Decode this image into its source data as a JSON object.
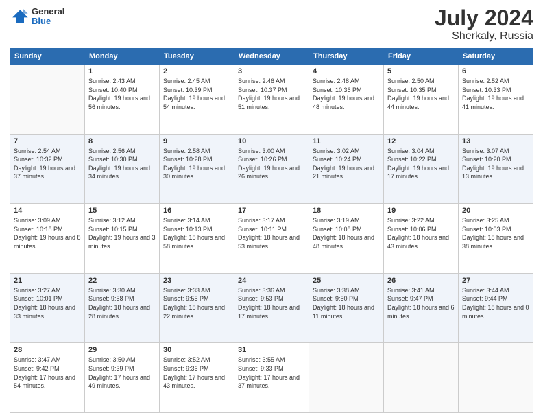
{
  "header": {
    "logo": {
      "general": "General",
      "blue": "Blue"
    },
    "month": "July 2024",
    "location": "Sherkaly, Russia"
  },
  "weekdays": [
    "Sunday",
    "Monday",
    "Tuesday",
    "Wednesday",
    "Thursday",
    "Friday",
    "Saturday"
  ],
  "weeks": [
    [
      {
        "day": "",
        "sunrise": "",
        "sunset": "",
        "daylight": ""
      },
      {
        "day": "1",
        "sunrise": "Sunrise: 2:43 AM",
        "sunset": "Sunset: 10:40 PM",
        "daylight": "Daylight: 19 hours and 56 minutes."
      },
      {
        "day": "2",
        "sunrise": "Sunrise: 2:45 AM",
        "sunset": "Sunset: 10:39 PM",
        "daylight": "Daylight: 19 hours and 54 minutes."
      },
      {
        "day": "3",
        "sunrise": "Sunrise: 2:46 AM",
        "sunset": "Sunset: 10:37 PM",
        "daylight": "Daylight: 19 hours and 51 minutes."
      },
      {
        "day": "4",
        "sunrise": "Sunrise: 2:48 AM",
        "sunset": "Sunset: 10:36 PM",
        "daylight": "Daylight: 19 hours and 48 minutes."
      },
      {
        "day": "5",
        "sunrise": "Sunrise: 2:50 AM",
        "sunset": "Sunset: 10:35 PM",
        "daylight": "Daylight: 19 hours and 44 minutes."
      },
      {
        "day": "6",
        "sunrise": "Sunrise: 2:52 AM",
        "sunset": "Sunset: 10:33 PM",
        "daylight": "Daylight: 19 hours and 41 minutes."
      }
    ],
    [
      {
        "day": "7",
        "sunrise": "Sunrise: 2:54 AM",
        "sunset": "Sunset: 10:32 PM",
        "daylight": "Daylight: 19 hours and 37 minutes."
      },
      {
        "day": "8",
        "sunrise": "Sunrise: 2:56 AM",
        "sunset": "Sunset: 10:30 PM",
        "daylight": "Daylight: 19 hours and 34 minutes."
      },
      {
        "day": "9",
        "sunrise": "Sunrise: 2:58 AM",
        "sunset": "Sunset: 10:28 PM",
        "daylight": "Daylight: 19 hours and 30 minutes."
      },
      {
        "day": "10",
        "sunrise": "Sunrise: 3:00 AM",
        "sunset": "Sunset: 10:26 PM",
        "daylight": "Daylight: 19 hours and 26 minutes."
      },
      {
        "day": "11",
        "sunrise": "Sunrise: 3:02 AM",
        "sunset": "Sunset: 10:24 PM",
        "daylight": "Daylight: 19 hours and 21 minutes."
      },
      {
        "day": "12",
        "sunrise": "Sunrise: 3:04 AM",
        "sunset": "Sunset: 10:22 PM",
        "daylight": "Daylight: 19 hours and 17 minutes."
      },
      {
        "day": "13",
        "sunrise": "Sunrise: 3:07 AM",
        "sunset": "Sunset: 10:20 PM",
        "daylight": "Daylight: 19 hours and 13 minutes."
      }
    ],
    [
      {
        "day": "14",
        "sunrise": "Sunrise: 3:09 AM",
        "sunset": "Sunset: 10:18 PM",
        "daylight": "Daylight: 19 hours and 8 minutes."
      },
      {
        "day": "15",
        "sunrise": "Sunrise: 3:12 AM",
        "sunset": "Sunset: 10:15 PM",
        "daylight": "Daylight: 19 hours and 3 minutes."
      },
      {
        "day": "16",
        "sunrise": "Sunrise: 3:14 AM",
        "sunset": "Sunset: 10:13 PM",
        "daylight": "Daylight: 18 hours and 58 minutes."
      },
      {
        "day": "17",
        "sunrise": "Sunrise: 3:17 AM",
        "sunset": "Sunset: 10:11 PM",
        "daylight": "Daylight: 18 hours and 53 minutes."
      },
      {
        "day": "18",
        "sunrise": "Sunrise: 3:19 AM",
        "sunset": "Sunset: 10:08 PM",
        "daylight": "Daylight: 18 hours and 48 minutes."
      },
      {
        "day": "19",
        "sunrise": "Sunrise: 3:22 AM",
        "sunset": "Sunset: 10:06 PM",
        "daylight": "Daylight: 18 hours and 43 minutes."
      },
      {
        "day": "20",
        "sunrise": "Sunrise: 3:25 AM",
        "sunset": "Sunset: 10:03 PM",
        "daylight": "Daylight: 18 hours and 38 minutes."
      }
    ],
    [
      {
        "day": "21",
        "sunrise": "Sunrise: 3:27 AM",
        "sunset": "Sunset: 10:01 PM",
        "daylight": "Daylight: 18 hours and 33 minutes."
      },
      {
        "day": "22",
        "sunrise": "Sunrise: 3:30 AM",
        "sunset": "Sunset: 9:58 PM",
        "daylight": "Daylight: 18 hours and 28 minutes."
      },
      {
        "day": "23",
        "sunrise": "Sunrise: 3:33 AM",
        "sunset": "Sunset: 9:55 PM",
        "daylight": "Daylight: 18 hours and 22 minutes."
      },
      {
        "day": "24",
        "sunrise": "Sunrise: 3:36 AM",
        "sunset": "Sunset: 9:53 PM",
        "daylight": "Daylight: 18 hours and 17 minutes."
      },
      {
        "day": "25",
        "sunrise": "Sunrise: 3:38 AM",
        "sunset": "Sunset: 9:50 PM",
        "daylight": "Daylight: 18 hours and 11 minutes."
      },
      {
        "day": "26",
        "sunrise": "Sunrise: 3:41 AM",
        "sunset": "Sunset: 9:47 PM",
        "daylight": "Daylight: 18 hours and 6 minutes."
      },
      {
        "day": "27",
        "sunrise": "Sunrise: 3:44 AM",
        "sunset": "Sunset: 9:44 PM",
        "daylight": "Daylight: 18 hours and 0 minutes."
      }
    ],
    [
      {
        "day": "28",
        "sunrise": "Sunrise: 3:47 AM",
        "sunset": "Sunset: 9:42 PM",
        "daylight": "Daylight: 17 hours and 54 minutes."
      },
      {
        "day": "29",
        "sunrise": "Sunrise: 3:50 AM",
        "sunset": "Sunset: 9:39 PM",
        "daylight": "Daylight: 17 hours and 49 minutes."
      },
      {
        "day": "30",
        "sunrise": "Sunrise: 3:52 AM",
        "sunset": "Sunset: 9:36 PM",
        "daylight": "Daylight: 17 hours and 43 minutes."
      },
      {
        "day": "31",
        "sunrise": "Sunrise: 3:55 AM",
        "sunset": "Sunset: 9:33 PM",
        "daylight": "Daylight: 17 hours and 37 minutes."
      },
      {
        "day": "",
        "sunrise": "",
        "sunset": "",
        "daylight": ""
      },
      {
        "day": "",
        "sunrise": "",
        "sunset": "",
        "daylight": ""
      },
      {
        "day": "",
        "sunrise": "",
        "sunset": "",
        "daylight": ""
      }
    ]
  ]
}
